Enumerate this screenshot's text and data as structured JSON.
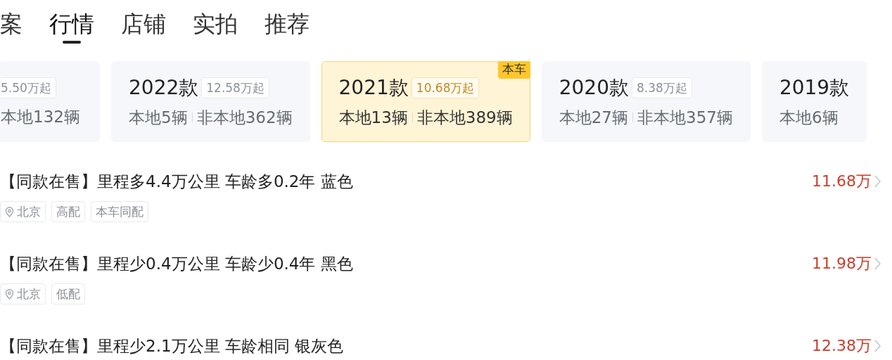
{
  "tabs": [
    {
      "label": "案",
      "selected": false
    },
    {
      "label": "行情",
      "selected": true
    },
    {
      "label": "店铺",
      "selected": false
    },
    {
      "label": "实拍",
      "selected": false
    },
    {
      "label": "推荐",
      "selected": false
    }
  ],
  "model_years": [
    {
      "kind": "partial",
      "price": "5.50万起",
      "local": "本地132辆",
      "selected": false
    },
    {
      "kind": "full",
      "year": "2022款",
      "price": "12.58万起",
      "local": "本地5辆",
      "nonlocal": "非本地362辆",
      "selected": false
    },
    {
      "kind": "full",
      "year": "2021款",
      "price": "10.68万起",
      "local": "本地13辆",
      "nonlocal": "非本地389辆",
      "selected": true,
      "badge": "本车"
    },
    {
      "kind": "full",
      "year": "2020款",
      "price": "8.38万起",
      "local": "本地27辆",
      "nonlocal": "非本地357辆",
      "selected": false
    },
    {
      "kind": "full",
      "year": "2019款",
      "local": "本地6辆",
      "selected": false
    }
  ],
  "listings": [
    {
      "title": "【同款在售】里程多4.4万公里 车龄多0.2年 蓝色",
      "location": "北京",
      "tags": [
        "高配",
        "本车同配"
      ],
      "price": "11.68万"
    },
    {
      "title": "【同款在售】里程少0.4万公里 车龄少0.4年 黑色",
      "location": "北京",
      "tags": [
        "低配"
      ],
      "price": "11.98万"
    },
    {
      "title": "【同款在售】里程少2.1万公里 车龄相同 银灰色",
      "price": "12.38万"
    }
  ]
}
